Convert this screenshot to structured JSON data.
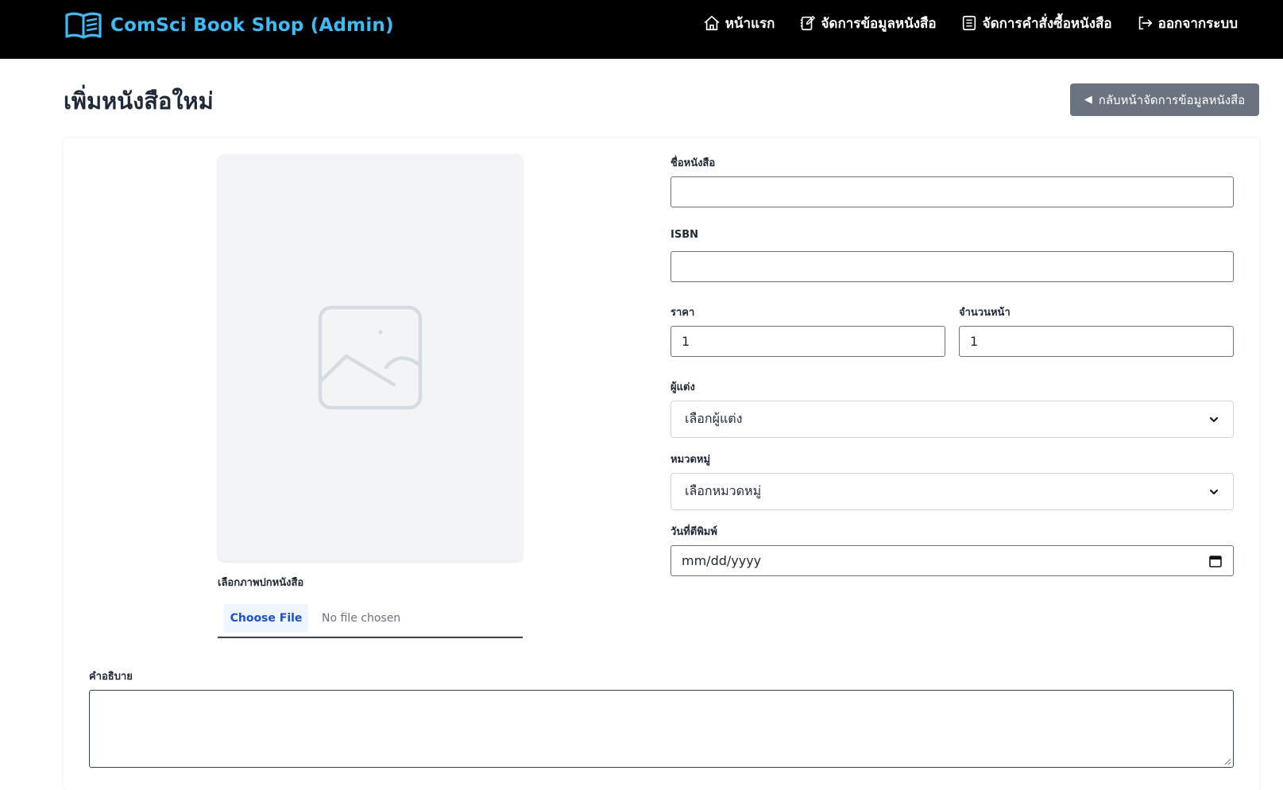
{
  "brand": {
    "name": "ComSci Book Shop (Admin)",
    "color": "#38bdf8"
  },
  "nav": {
    "items": [
      {
        "label": "หน้าแรก",
        "icon": "home-icon"
      },
      {
        "label": "จัดการข้อมูลหนังสือ",
        "icon": "notebook-edit-icon"
      },
      {
        "label": "จัดการคำสั่งซื้อหนังสือ",
        "icon": "document-list-icon"
      },
      {
        "label": "ออกจากระบบ",
        "icon": "logout-icon"
      }
    ]
  },
  "page": {
    "title": "เพิ่มหนังสือใหม่",
    "back_button": "กลับหน้าจัดการข้อมูลหนังสือ",
    "back_icon": "◀"
  },
  "form": {
    "cover": {
      "label": "เลือกภาพปกหนังสือ",
      "choose_file": "Choose File",
      "file_status": "No file chosen",
      "placeholder_icon": "image-placeholder-icon"
    },
    "title": {
      "label": "ชื่อหนังสือ",
      "value": ""
    },
    "isbn": {
      "label": "ISBN",
      "value": ""
    },
    "price": {
      "label": "ราคา",
      "value": "1"
    },
    "pages": {
      "label": "จำนวนหน้า",
      "value": "1"
    },
    "author": {
      "label": "ผู้แต่ง",
      "selected": "เลือกผู้แต่ง"
    },
    "category": {
      "label": "หมวดหมู่",
      "selected": "เลือกหมวดหมู่"
    },
    "publish_date": {
      "label": "วันที่ตีพิมพ์",
      "value": "mm/dd/yyyy"
    },
    "description": {
      "label": "คำอธิบาย",
      "value": ""
    }
  },
  "colors": {
    "topbar": "#000000",
    "back_button": "#6b7280",
    "file_button_bg": "#eff6ff",
    "file_button_text": "#1d4ed8"
  }
}
